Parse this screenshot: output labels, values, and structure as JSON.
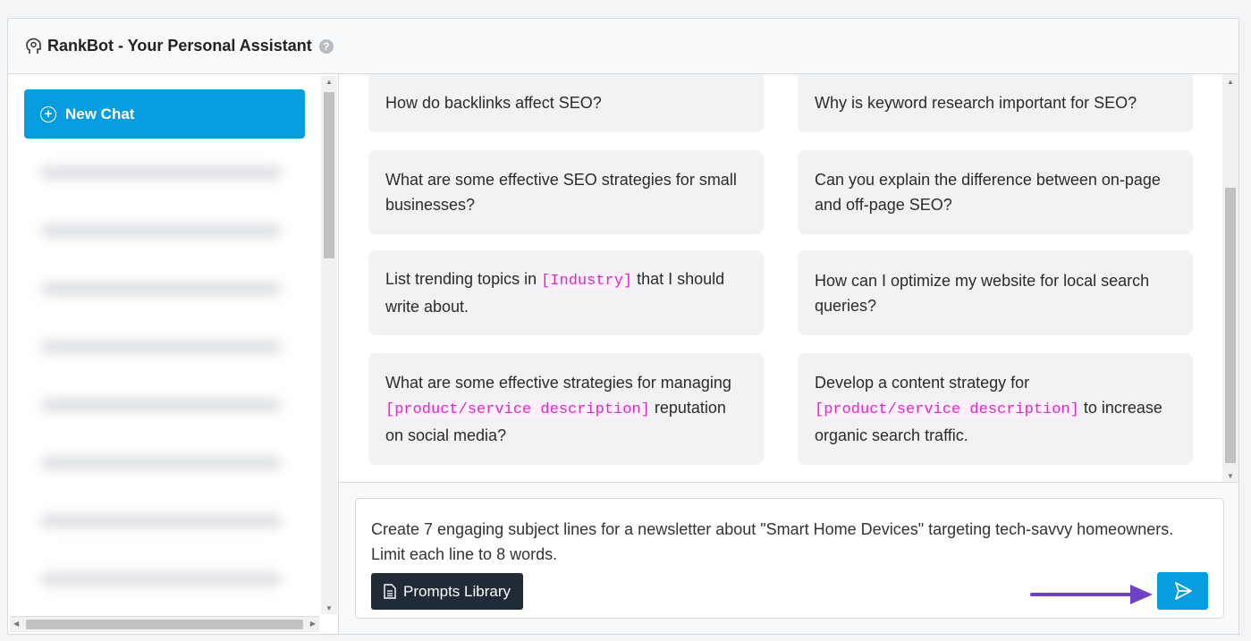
{
  "header": {
    "title": "RankBot - Your Personal Assistant",
    "help": "?"
  },
  "sidebar": {
    "new_chat": "New Chat"
  },
  "cards": [
    {
      "parts": [
        {
          "t": "How do backlinks affect SEO?"
        }
      ]
    },
    {
      "parts": [
        {
          "t": "Why is keyword research important for SEO?"
        }
      ]
    },
    {
      "parts": [
        {
          "t": "What are some effective SEO strategies for small businesses?"
        }
      ]
    },
    {
      "parts": [
        {
          "t": "Can you explain the difference between on-page and off-page SEO?"
        }
      ]
    },
    {
      "parts": [
        {
          "t": "List trending topics in "
        },
        {
          "p": "[Industry]"
        },
        {
          "t": " that I should write about."
        }
      ]
    },
    {
      "parts": [
        {
          "t": "How can I optimize my website for local search queries?"
        }
      ]
    },
    {
      "parts": [
        {
          "t": "What are some effective strategies for managing "
        },
        {
          "p": "[product/service description]"
        },
        {
          "t": " reputation on social media?"
        }
      ]
    },
    {
      "parts": [
        {
          "t": "Develop a content strategy for "
        },
        {
          "p": "[product/service description]"
        },
        {
          "t": " to increase organic search traffic."
        }
      ]
    }
  ],
  "input": {
    "value": "Create 7 engaging subject lines for a newsletter about \"Smart Home Devices\" targeting tech-savvy homeowners. Limit each line to 8 words.",
    "prompts_library": "Prompts Library"
  },
  "colors": {
    "accent": "#069de0",
    "placeholder": "#d629c7",
    "arrow": "#6f42c1",
    "dark_button": "#212b37"
  }
}
